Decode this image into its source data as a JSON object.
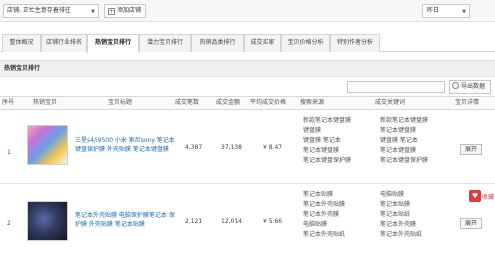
{
  "topbar": {
    "shop_value": "店铺: 正忙生意存着徘往",
    "add_shop_label": "添加店铺",
    "period_value": "昨日"
  },
  "tabs": [
    {
      "label": "整体概况"
    },
    {
      "label": "店铺行业排名"
    },
    {
      "label": "热销宝贝排行"
    },
    {
      "label": "潜力宝贝排行"
    },
    {
      "label": "热销品类排行"
    },
    {
      "label": "成交买家"
    },
    {
      "label": "宝贝价格分析"
    },
    {
      "label": "特别作者分析"
    }
  ],
  "section": {
    "title": "热销宝贝排行"
  },
  "toolbar": {
    "search_placeholder": "",
    "export_label": "导出数据"
  },
  "table": {
    "headers": [
      "序号",
      "热销宝贝",
      "宝贝标题",
      "成交笔数",
      "成交金额",
      "平均成交价格",
      "搜索来源",
      "成交关键词",
      "宝贝详情"
    ],
    "rows": [
      {
        "index": "1",
        "title": "三星s4/i9500 小米 索尼sony 笔记本键盘保护膜 外壳贴膜 笔记本键盘膜",
        "orders": "4,387",
        "amount": "37,138",
        "avg_price": "¥ 8.47",
        "search_keywords": [
          "新款笔记本键盘膜",
          "键盘膜",
          "键盘膜 笔记本",
          "笔记本键盘膜",
          "笔记本键盘保护膜"
        ],
        "deal_keywords": [
          "新款笔记本键盘膜",
          "笔记本键盘膜",
          "键盘膜 笔记本",
          "笔记本键盘膜",
          "笔记本键盘保护膜"
        ],
        "detail_label": "展开"
      },
      {
        "index": "2",
        "title": "笔记本外壳贴膜 电脑保护膜笔记本 保护膜 外壳贴膜 笔记本贴膜",
        "orders": "2,121",
        "amount": "12,014",
        "avg_price": "¥ 5.66",
        "search_keywords": [
          "笔记本贴膜",
          "笔记本外壳贴膜",
          "笔记本外壳膜",
          "电脑贴膜",
          "笔记本外壳贴纸"
        ],
        "deal_keywords": [
          "电脑贴膜",
          "笔记本贴膜",
          "笔记本贴纸",
          "笔记本外壳膜",
          "笔记本外壳贴纸"
        ],
        "detail_label": "展开"
      }
    ]
  },
  "favorite": {
    "icon": "heart-icon",
    "label": "收藏"
  }
}
